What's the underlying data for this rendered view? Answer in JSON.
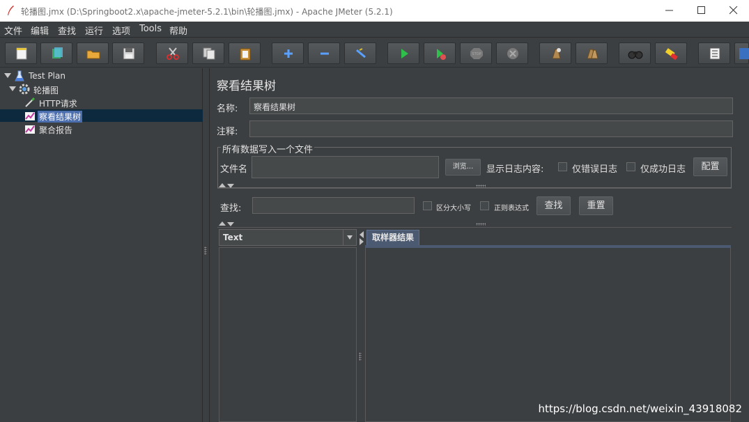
{
  "window": {
    "title": "轮播图.jmx (D:\\Springboot2.x\\apache-jmeter-5.2.1\\bin\\轮播图.jmx) - Apache JMeter (5.2.1)",
    "app_icon": "jmeter-feather-icon"
  },
  "menu": [
    "文件",
    "编辑",
    "查找",
    "运行",
    "选项",
    "Tools",
    "帮助"
  ],
  "toolbar": [
    {
      "name": "new-icon"
    },
    {
      "name": "templates-icon"
    },
    {
      "name": "open-icon"
    },
    {
      "name": "save-icon"
    },
    {
      "name": "cut-icon"
    },
    {
      "name": "copy-icon"
    },
    {
      "name": "paste-icon"
    },
    {
      "name": "expand-icon"
    },
    {
      "name": "collapse-icon"
    },
    {
      "name": "toggle-icon"
    },
    {
      "name": "start-icon"
    },
    {
      "name": "start-no-pause-icon"
    },
    {
      "name": "stop-icon"
    },
    {
      "name": "shutdown-icon"
    },
    {
      "name": "clear-icon"
    },
    {
      "name": "clear-all-icon"
    },
    {
      "name": "search-binoculars-icon"
    },
    {
      "name": "reset-search-icon"
    },
    {
      "name": "function-helper-icon"
    },
    {
      "name": "help-icon"
    }
  ],
  "tree": {
    "items": [
      {
        "label": "Test Plan",
        "icon": "flask-icon"
      },
      {
        "label": "轮播图",
        "icon": "gear-icon"
      },
      {
        "label": "HTTP请求",
        "icon": "pipette-icon"
      },
      {
        "label": "察看结果树",
        "icon": "graph-icon",
        "selected": true
      },
      {
        "label": "聚合报告",
        "icon": "graph-icon"
      }
    ]
  },
  "panel": {
    "heading": "察看结果树",
    "name_label": "名称:",
    "name_value": "察看结果树",
    "comment_label": "注释:",
    "comment_value": "",
    "file_group_title": "所有数据写入一个文件",
    "filename_label": "文件名",
    "browse_label": "浏览...",
    "log_label": "显示日志内容:",
    "errors_only": "仅错误日志",
    "success_only": "仅成功日志",
    "configure": "配置",
    "search_label": "查找:",
    "case_sensitive": "区分大小写",
    "regex": "正则表达式",
    "search_btn": "查找",
    "reset_btn": "重置",
    "renderer": "Text",
    "tab": "取样器结果"
  },
  "watermark": "https://blog.csdn.net/weixin_43918082"
}
